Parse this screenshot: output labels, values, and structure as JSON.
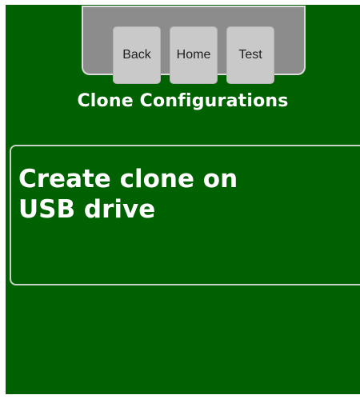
{
  "nav": {
    "back_label": "Back",
    "home_label": "Home",
    "test_label": "Test"
  },
  "page": {
    "title": "Clone Configurations"
  },
  "options": [
    {
      "label": "Create clone on USB drive"
    }
  ],
  "colors": {
    "background": "#006100",
    "nav_panel": "#8c8c8c",
    "button": "#c9c9c9",
    "text": "#ffffff"
  }
}
